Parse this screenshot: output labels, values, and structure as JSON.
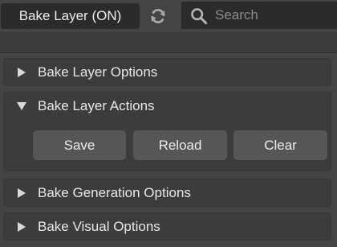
{
  "toolbar": {
    "layer_button_label": "Bake Layer (ON)",
    "refresh_icon": "refresh-icon",
    "search": {
      "icon": "search-icon",
      "placeholder": "Search",
      "value": ""
    }
  },
  "panels": [
    {
      "title": "Bake Layer Options",
      "expanded": false
    },
    {
      "title": "Bake Layer Actions",
      "expanded": true,
      "buttons": [
        "Save",
        "Reload",
        "Clear"
      ]
    },
    {
      "title": "Bake Generation Options",
      "expanded": false
    },
    {
      "title": "Bake Visual Options",
      "expanded": false
    }
  ],
  "colors": {
    "background": "#444444",
    "panel": "#3c3c3c",
    "button": "#565656",
    "field": "#2b2b2b",
    "text": "#e8e8e8"
  }
}
